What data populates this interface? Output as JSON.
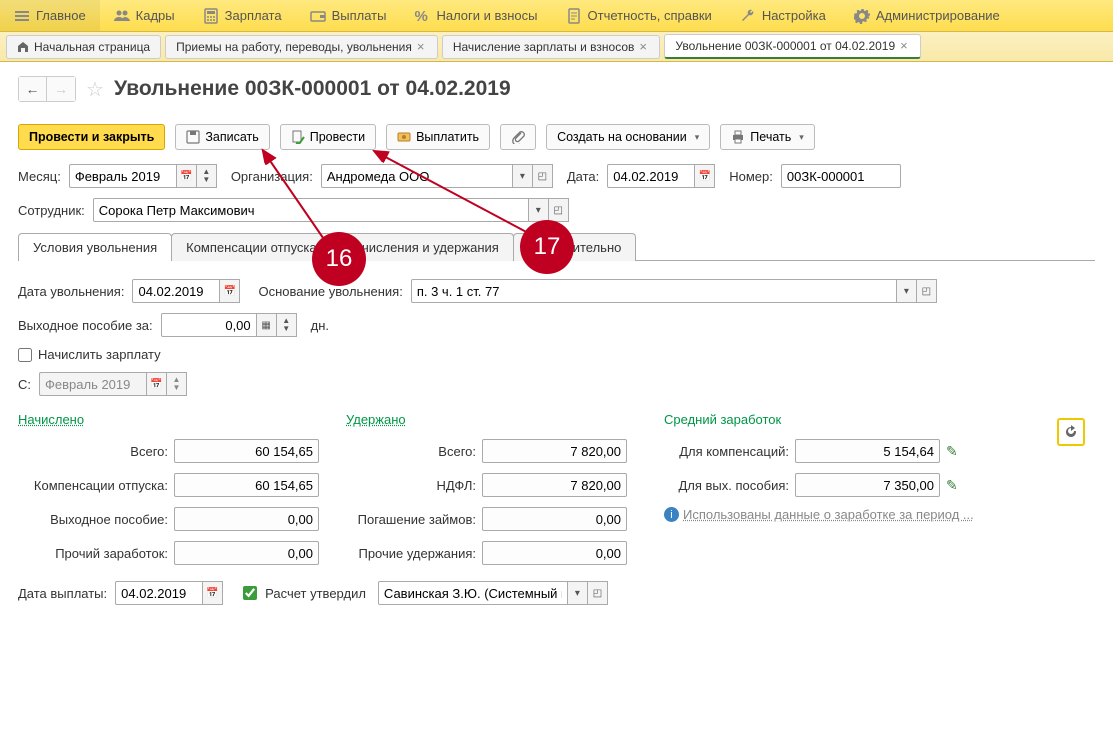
{
  "menu": [
    {
      "icon": "bars",
      "label": "Главное"
    },
    {
      "icon": "users",
      "label": "Кадры"
    },
    {
      "icon": "calculator",
      "label": "Зарплата"
    },
    {
      "icon": "wallet",
      "label": "Выплаты"
    },
    {
      "icon": "percent",
      "label": "Налоги и взносы"
    },
    {
      "icon": "doc",
      "label": "Отчетность, справки"
    },
    {
      "icon": "wrench",
      "label": "Настройка"
    },
    {
      "icon": "gear",
      "label": "Администрирование"
    }
  ],
  "tabs": [
    {
      "label": "Начальная страница",
      "closable": false,
      "home": true
    },
    {
      "label": "Приемы на работу, переводы, увольнения",
      "closable": true
    },
    {
      "label": "Начисление зарплаты и взносов",
      "closable": true
    },
    {
      "label": "Увольнение 00ЗК-000001 от 04.02.2019",
      "closable": true,
      "active": true
    }
  ],
  "page_title": "Увольнение 00ЗК-000001 от 04.02.2019",
  "toolbar": {
    "post_close": "Провести и закрыть",
    "save": "Записать",
    "post": "Провести",
    "pay": "Выплатить",
    "create_based": "Создать на основании",
    "print": "Печать"
  },
  "fields": {
    "month_label": "Месяц:",
    "month_value": "Февраль 2019",
    "org_label": "Организация:",
    "org_value": "Андромеда ООО",
    "date_label": "Дата:",
    "date_value": "04.02.2019",
    "number_label": "Номер:",
    "number_value": "00ЗК-000001",
    "employee_label": "Сотрудник:",
    "employee_value": "Сорока Петр Максимович"
  },
  "doc_tabs": [
    "Условия увольнения",
    "Компенсации отпуска",
    "Начисления и удержания",
    "Дополнительно"
  ],
  "conditions": {
    "dismiss_date_label": "Дата увольнения:",
    "dismiss_date_value": "04.02.2019",
    "basis_label": "Основание увольнения:",
    "basis_value": "п. 3 ч. 1 ст. 77",
    "severance_label": "Выходное пособие за:",
    "severance_value": "0,00",
    "severance_unit": "дн.",
    "accrue_salary_label": "Начислить зарплату",
    "from_label": "С:",
    "from_value": "Февраль 2019"
  },
  "totals": {
    "accrued_head": "Начислено",
    "withheld_head": "Удержано",
    "average_head": "Средний заработок",
    "accrued": {
      "total_label": "Всего:",
      "total_value": "60 154,65",
      "comp_label": "Компенсации отпуска:",
      "comp_value": "60 154,65",
      "severance_label": "Выходное пособие:",
      "severance_value": "0,00",
      "other_label": "Прочий заработок:",
      "other_value": "0,00"
    },
    "withheld": {
      "total_label": "Всего:",
      "total_value": "7 820,00",
      "ndfl_label": "НДФЛ:",
      "ndfl_value": "7 820,00",
      "loan_label": "Погашение займов:",
      "loan_value": "0,00",
      "other_label": "Прочие удержания:",
      "other_value": "0,00"
    },
    "average": {
      "comp_label": "Для компенсаций:",
      "comp_value": "5 154,64",
      "severance_label": "Для вых. пособия:",
      "severance_value": "7 350,00",
      "info_text": "Использованы данные о заработке за период ..."
    }
  },
  "footer": {
    "pay_date_label": "Дата выплаты:",
    "pay_date_value": "04.02.2019",
    "approved_label": "Расчет утвердил",
    "approver_value": "Савинская З.Ю. (Системный п"
  },
  "annotations": {
    "a16": "16",
    "a17": "17"
  }
}
